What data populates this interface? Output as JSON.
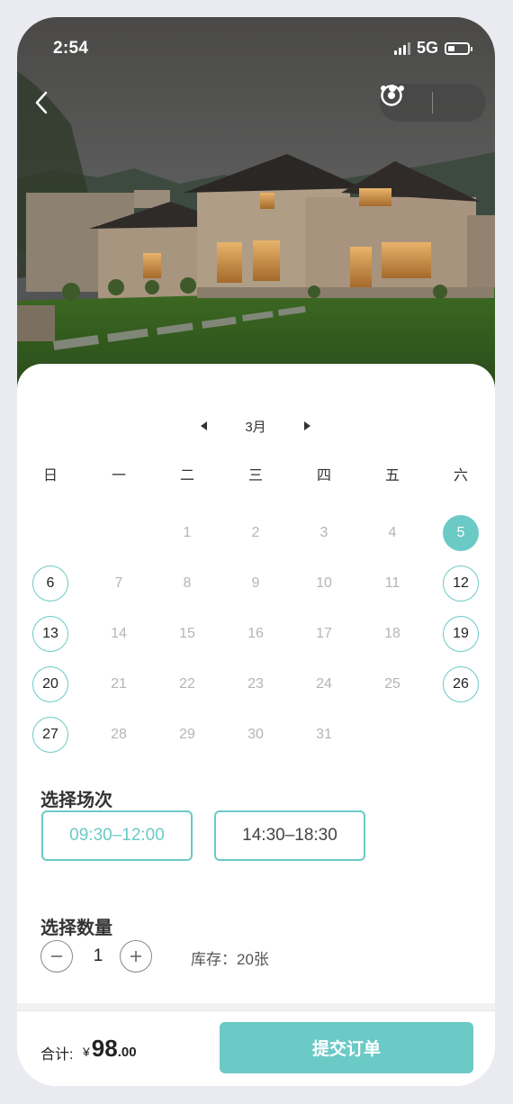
{
  "status": {
    "time": "2:54",
    "network": "5G"
  },
  "calendar": {
    "month": "3月",
    "weekdays": [
      "日",
      "一",
      "二",
      "三",
      "四",
      "五",
      "六"
    ],
    "weeks": [
      [
        null,
        null,
        "1",
        "2",
        "3",
        "4",
        "5"
      ],
      [
        "6",
        "7",
        "8",
        "9",
        "10",
        "11",
        "12"
      ],
      [
        "13",
        "14",
        "15",
        "16",
        "17",
        "18",
        "19"
      ],
      [
        "20",
        "21",
        "22",
        "23",
        "24",
        "25",
        "26"
      ],
      [
        "27",
        "28",
        "29",
        "30",
        "31",
        null,
        null
      ]
    ],
    "available": [
      "6",
      "12",
      "13",
      "19",
      "20",
      "26",
      "27"
    ],
    "selected": "5"
  },
  "session": {
    "title": "选择场次",
    "options": [
      "09:30–12:00",
      "14:30–18:30"
    ],
    "selected_index": 0
  },
  "quantity": {
    "title": "选择数量",
    "value": "1",
    "stock_label": "库存：",
    "stock_value": "20张"
  },
  "footer": {
    "total_label": "合计:",
    "currency": "¥",
    "price_int": "98",
    "price_dec": ".00",
    "submit_label": "提交订单"
  },
  "colors": {
    "accent": "#6bcac6"
  },
  "icons": {
    "back": "chevron-left-icon",
    "more": "more-dots-icon",
    "close": "target-circle-icon",
    "prev": "triangle-left-icon",
    "next": "triangle-right-icon",
    "minus": "minus-icon",
    "plus": "plus-icon"
  }
}
